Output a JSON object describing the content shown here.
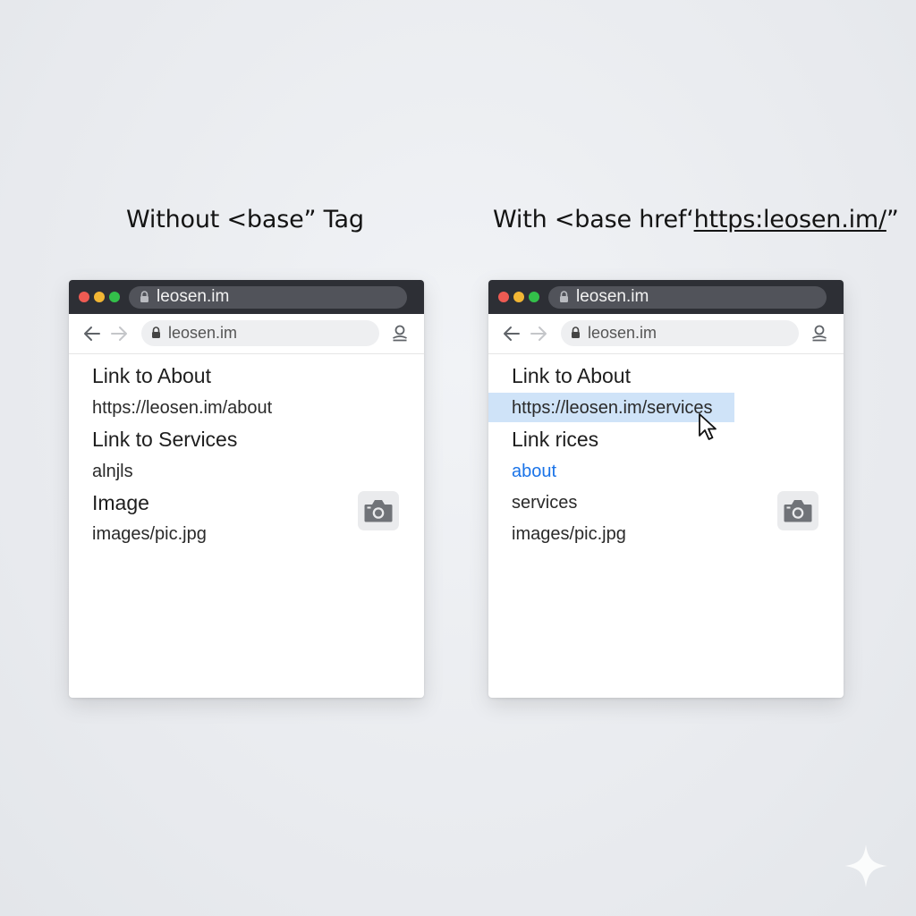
{
  "headings": {
    "left": "Without <base” Tag",
    "right_prefix": "With <base href‘",
    "right_url": "https:leosen.im/",
    "right_suffix": "”"
  },
  "windows": [
    {
      "tab_title": "leosen.im",
      "address": "leosen.im",
      "lines": [
        "Link to About",
        "https://leosen.im/about",
        "Link to Services",
        "alnjls",
        "Image",
        "images/pic.jpg"
      ]
    },
    {
      "tab_title": "leosen.im",
      "address": "leosen.im",
      "lines": [
        "Link to About",
        "https://leosen.im/services",
        "Link rices",
        "about",
        "services",
        "images/pic.jpg"
      ]
    }
  ],
  "icons": {
    "lock": "lock-icon",
    "back": "arrow-left-icon",
    "forward": "arrow-right-icon",
    "profile": "user-icon",
    "image": "camera-icon",
    "pointer": "mouse-cursor-icon",
    "watermark": "sparkle-icon"
  },
  "colors": {
    "titlebar": "#2d2f35",
    "link": "#1a73e8",
    "highlight": "#cfe3f8"
  }
}
